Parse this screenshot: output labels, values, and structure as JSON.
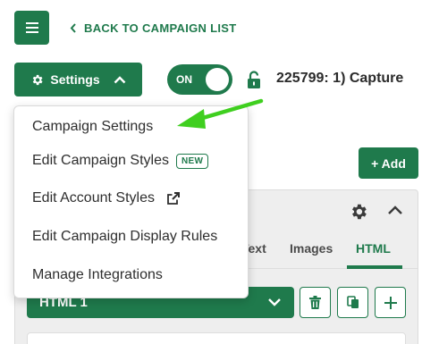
{
  "nav": {
    "back_label": "BACK TO CAMPAIGN LIST"
  },
  "toolbar": {
    "settings_label": "Settings",
    "toggle_label": "ON",
    "campaign_title": "225799: 1) Capture",
    "add_label": "+ Add"
  },
  "dropdown": {
    "items": [
      {
        "label": "Campaign Settings"
      },
      {
        "label": "Edit Campaign Styles",
        "badge": "NEW"
      },
      {
        "label": "Edit Account Styles"
      },
      {
        "label": "Edit Campaign Display Rules"
      },
      {
        "label": "Manage Integrations"
      }
    ]
  },
  "panel": {
    "tabs": [
      {
        "label": "Text"
      },
      {
        "label": "Images"
      },
      {
        "label": "HTML"
      }
    ],
    "active_tab": "HTML",
    "html_select_value": "HTML 1"
  },
  "colors": {
    "brand_green": "#1f7a4c",
    "arrow_green": "#3fcf1f"
  },
  "icons": {
    "menu": "hamburger-icon",
    "back": "chevron-left-icon",
    "settings": "gear-icon",
    "collapse": "chevron-up-icon",
    "lock": "lock-open-icon",
    "external": "external-link-icon",
    "delete": "trash-icon",
    "duplicate": "copy-icon",
    "add": "plus-icon"
  }
}
